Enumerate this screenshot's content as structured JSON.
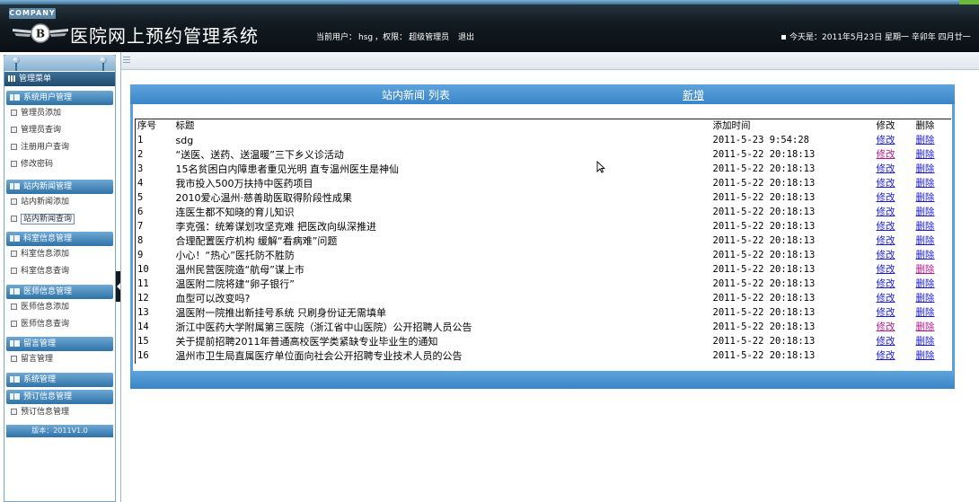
{
  "header": {
    "company": "COMPANY",
    "app_title": "医院网上预约管理系统",
    "current_user_label": "当前用户：",
    "current_user": "hsg",
    "permission_label": "，权限：",
    "permission": "超级管理员",
    "logout": "退出",
    "today_label": "今天是：",
    "today": "2011年5月23日 星期一 辛卯年 四月廿一"
  },
  "sidebar": {
    "title": "管理菜单",
    "groups": [
      {
        "label": "系统用户管理",
        "items": [
          "管理员添加",
          "管理员查询",
          "注册用户查询",
          "修改密码"
        ]
      },
      {
        "label": "站内新闻管理",
        "items": [
          "站内新闻添加",
          "站内新闻查询"
        ]
      },
      {
        "label": "科室信息管理",
        "items": [
          "科室信息添加",
          "科室信息查询"
        ]
      },
      {
        "label": "医师信息管理",
        "items": [
          "医师信息添加",
          "医师信息查询"
        ]
      },
      {
        "label": "留言管理",
        "items": [
          "留言管理"
        ]
      },
      {
        "label": "系统管理",
        "items": []
      },
      {
        "label": "预订信息管理",
        "items": [
          "预订信息管理"
        ]
      }
    ],
    "version": "版本：2011V1.0"
  },
  "panel": {
    "title": "站内新闻 列表",
    "add_link": "新增"
  },
  "table": {
    "headers": [
      "序号",
      "标题",
      "添加时间",
      "修改",
      "删除"
    ],
    "edit_label": "修改",
    "delete_label": "删除",
    "rows": [
      {
        "no": "1",
        "title": "sdg",
        "time": "2011-5-23 9:54:28"
      },
      {
        "no": "2",
        "title": "“送医、送药、送温暖”三下乡义诊活动",
        "time": "2011-5-22 20:18:13"
      },
      {
        "no": "3",
        "title": "15名贫困白内障患者重见光明 直专温州医生是神仙",
        "time": "2011-5-22 20:18:13"
      },
      {
        "no": "4",
        "title": "我市投入500万扶持中医药项目",
        "time": "2011-5-22 20:18:13"
      },
      {
        "no": "5",
        "title": "2010爱心温州·慈善助医取得阶段性成果",
        "time": "2011-5-22 20:18:13"
      },
      {
        "no": "6",
        "title": "连医生都不知晓的育儿知识",
        "time": "2011-5-22 20:18:13"
      },
      {
        "no": "7",
        "title": "李克强：统筹谋划攻坚克难 把医改向纵深推进",
        "time": "2011-5-22 20:18:13"
      },
      {
        "no": "8",
        "title": "合理配置医疗机构 缓解“看病难”问题",
        "time": "2011-5-22 20:18:13"
      },
      {
        "no": "9",
        "title": "小心！“热心”医托防不胜防",
        "time": "2011-5-22 20:18:13"
      },
      {
        "no": "10",
        "title": "温州民营医院造“航母”谋上市",
        "time": "2011-5-22 20:18:13"
      },
      {
        "no": "11",
        "title": "温医附二院将建“卵子银行”",
        "time": "2011-5-22 20:18:13"
      },
      {
        "no": "12",
        "title": "血型可以改变吗?",
        "time": "2011-5-22 20:18:13"
      },
      {
        "no": "13",
        "title": "温医附一院推出新挂号系统 只刷身份证无需填单",
        "time": "2011-5-22 20:18:13"
      },
      {
        "no": "14",
        "title": "浙江中医药大学附属第三医院（浙江省中山医院）公开招聘人员公告",
        "time": "2011-5-22 20:18:13"
      },
      {
        "no": "15",
        "title": "关于提前招聘2011年普通高校医学类紧缺专业毕业生的通知",
        "time": "2011-5-22 20:18:13"
      },
      {
        "no": "16",
        "title": "温州市卫生局直属医疗单位面向社会公开招聘专业技术人员的公告",
        "time": "2011-5-22 20:18:13"
      }
    ]
  },
  "colors": {
    "header_bg": "#121b22",
    "panel_blue": "#3a86c9",
    "menu_blue": "#2f73a8",
    "link": "#1a1ad6",
    "visited_link": "#b01a8a"
  }
}
